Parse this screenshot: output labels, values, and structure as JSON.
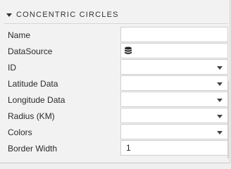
{
  "section": {
    "title": "CONCENTRIC CIRCLES"
  },
  "fields": [
    {
      "label": "Name",
      "type": "text",
      "value": ""
    },
    {
      "label": "DataSource",
      "type": "datasource",
      "icon": "database-icon",
      "value": ""
    },
    {
      "label": "ID",
      "type": "select",
      "value": ""
    },
    {
      "label": "Latitude Data",
      "type": "select",
      "value": ""
    },
    {
      "label": "Longitude Data",
      "type": "select",
      "value": ""
    },
    {
      "label": "Radius (KM)",
      "type": "select",
      "value": ""
    },
    {
      "label": "Colors",
      "type": "select",
      "value": ""
    },
    {
      "label": "Border Width",
      "type": "text",
      "value": "1"
    }
  ]
}
